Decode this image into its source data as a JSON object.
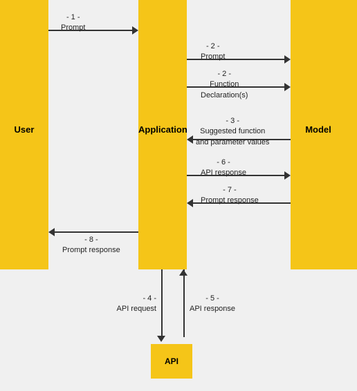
{
  "columns": {
    "user": "User",
    "application": "Application",
    "model": "Model",
    "api": "API"
  },
  "arrows": [
    {
      "id": "arrow1",
      "label_line1": "- 1 -",
      "label_line2": "Prompt"
    },
    {
      "id": "arrow2a",
      "label_line1": "- 2 -",
      "label_line2": "Prompt"
    },
    {
      "id": "arrow2b",
      "label_line1": "- 2 -",
      "label_line2": "Function",
      "label_line3": "Declaration(s)"
    },
    {
      "id": "arrow3",
      "label_line1": "- 3 -",
      "label_line2": "Suggested function",
      "label_line3": "and parameter values"
    },
    {
      "id": "arrow4",
      "label_line1": "- 4 -",
      "label_line2": "API request"
    },
    {
      "id": "arrow5",
      "label_line1": "- 5 -",
      "label_line2": "API response"
    },
    {
      "id": "arrow6",
      "label_line1": "- 6 -",
      "label_line2": "API response"
    },
    {
      "id": "arrow7",
      "label_line1": "- 7 -",
      "label_line2": "Prompt response"
    },
    {
      "id": "arrow8",
      "label_line1": "- 8 -",
      "label_line2": "Prompt response"
    }
  ]
}
